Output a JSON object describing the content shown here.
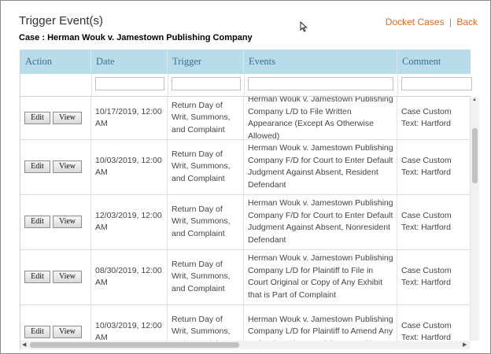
{
  "dialog": {
    "title": "Trigger Event(s)",
    "case_label": "Case : Herman Wouk v. Jamestown Publishing Company",
    "links": {
      "docket_cases": "Docket Cases",
      "separator": "|",
      "back": "Back"
    }
  },
  "table": {
    "headers": {
      "action": "Action",
      "date": "Date",
      "trigger": "Trigger",
      "events": "Events",
      "comment": "Comment"
    },
    "edit_label": "Edit",
    "view_label": "View",
    "rows": [
      {
        "date": "10/17/2019, 12:00 AM",
        "trigger": "Return Day of Writ, Summons, and Complaint",
        "events": "Herman Wouk v. Jamestown Publishing Company L/D to File Written Appearance (Except As Otherwise Allowed)",
        "comment": "Case Custom Text: Hartford"
      },
      {
        "date": "10/03/2019, 12:00 AM",
        "trigger": "Return Day of Writ, Summons, and Complaint",
        "events": "Herman Wouk v. Jamestown Publishing Company F/D for Court to Enter Default Judgment Against Absent, Resident Defendant",
        "comment": "Case Custom Text: Hartford"
      },
      {
        "date": "12/03/2019, 12:00 AM",
        "trigger": "Return Day of Writ, Summons, and Complaint",
        "events": "Herman Wouk v. Jamestown Publishing Company F/D for Court to Enter Default Judgment Against Absent, Nonresident Defendant",
        "comment": "Case Custom Text: Hartford"
      },
      {
        "date": "08/30/2019, 12:00 AM",
        "trigger": "Return Day of Writ, Summons, and Complaint",
        "events": "Herman Wouk v. Jamestown Publishing Company L/D for Plaintiff to File in Court Original or Copy of Any Exhibit that is Part of Complaint",
        "comment": "Case Custom Text: Hartford"
      },
      {
        "date": "10/03/2019, 12:00 AM",
        "trigger": "Return Day of Writ, Summons, and Complaint",
        "events": "Herman Wouk v. Jamestown Publishing Company L/D for Plaintiff to Amend Any Defect in Writ, Complaint, or Petition or",
        "comment": "Case Custom Text: Hartford"
      }
    ]
  }
}
